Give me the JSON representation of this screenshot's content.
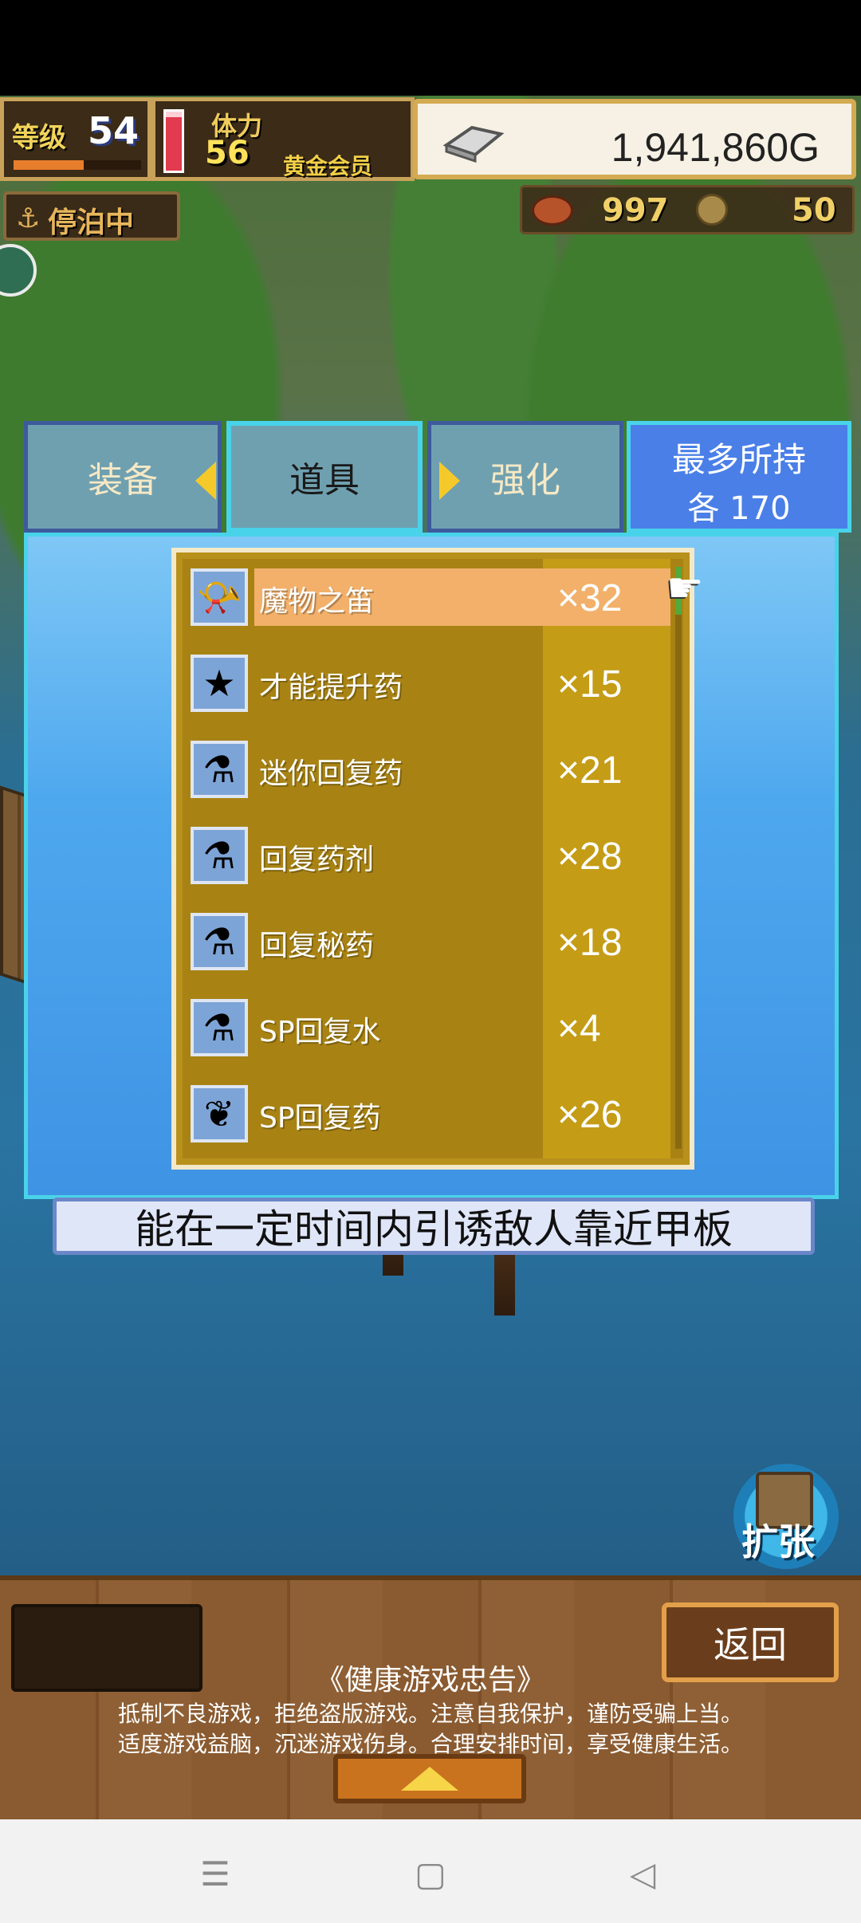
{
  "hud": {
    "level_label": "等级",
    "level_value": "54",
    "level_progress": 0.55,
    "stamina_label": "体力",
    "stamina_value": "56",
    "stamina_fill": 0.9,
    "member_label": "黄金会员",
    "money": "1,941,860G",
    "status_label": "停泊中",
    "food_value": "997",
    "coin_value": "50"
  },
  "tabs": {
    "equipment": "装备",
    "items": "道具",
    "enhance": "强化",
    "max_hold_title": "最多所持",
    "max_hold_value": "各 170"
  },
  "items": [
    {
      "icon": "flute-icon",
      "glyph": "📯",
      "name": "魔物之笛",
      "count": "×32",
      "selected": true
    },
    {
      "icon": "star-icon",
      "glyph": "★",
      "name": "才能提升药",
      "count": "×15",
      "selected": false
    },
    {
      "icon": "small-potion-icon",
      "glyph": "⚗",
      "name": "迷你回复药",
      "count": "×21",
      "selected": false
    },
    {
      "icon": "potion-icon",
      "glyph": "⚗",
      "name": "回复药剂",
      "count": "×28",
      "selected": false
    },
    {
      "icon": "secret-potion-icon",
      "glyph": "⚗",
      "name": "回复秘药",
      "count": "×18",
      "selected": false
    },
    {
      "icon": "sp-water-icon",
      "glyph": "⚗",
      "name": "SP回复水",
      "count": "×4",
      "selected": false
    },
    {
      "icon": "sp-herb-icon",
      "glyph": "❦",
      "name": "SP回复药",
      "count": "×26",
      "selected": false
    }
  ],
  "description": "能在一定时间内引诱敌人靠近甲板",
  "expand_label": "扩张",
  "bottom": {
    "back_label": "返回",
    "health_title": "《健康游戏忠告》",
    "health_line1": "抵制不良游戏，拒绝盗版游戏。注意自我保护，谨防受骗上当。",
    "health_line2": "适度游戏益脑，沉迷游戏伤身。合理安排时间，享受健康生活。"
  },
  "icons": {
    "anchor": "⚓",
    "pointer": "☚",
    "nav_menu": "☰",
    "nav_home": "▢",
    "nav_back": "◁"
  },
  "colors": {
    "panel_blue": "#4ea8ee",
    "selected_row": "#f2b06a",
    "list_gold": "#b8901c",
    "active_tab_border": "#49d3ea"
  }
}
